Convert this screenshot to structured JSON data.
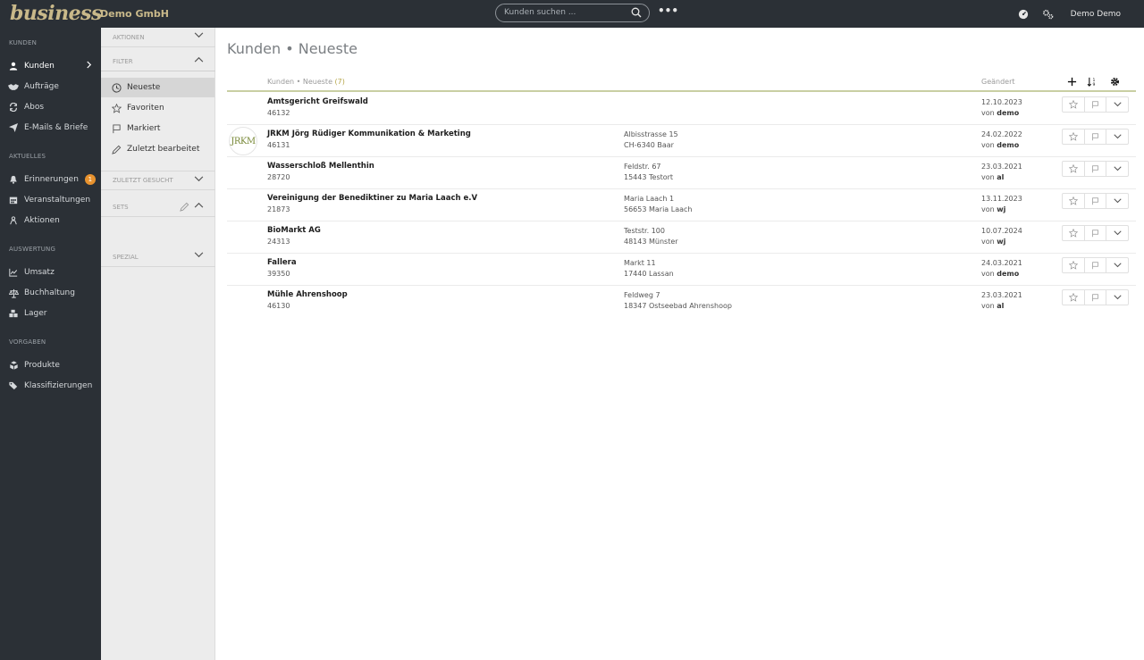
{
  "topbar": {
    "logo": "business",
    "company": "Demo GmbH",
    "search_placeholder": "Kunden suchen ...",
    "more": "•••",
    "user": "Demo Demo"
  },
  "sidebar": {
    "sections": {
      "kunden": "KUNDEN",
      "aktuelles": "AKTUELLES",
      "auswertung": "AUSWERTUNG",
      "vorgaben": "VORGABEN"
    },
    "items": [
      {
        "label": "Kunden",
        "icon": "user-icon"
      },
      {
        "label": "Aufträge",
        "icon": "handshake-icon"
      },
      {
        "label": "Abos",
        "icon": "refresh-icon"
      },
      {
        "label": "E-Mails & Briefe",
        "icon": "paper-plane-icon"
      },
      {
        "label": "Erinnerungen",
        "icon": "bell-icon",
        "badge": "1"
      },
      {
        "label": "Veranstaltungen",
        "icon": "calendar-icon"
      },
      {
        "label": "Aktionen",
        "icon": "people-icon"
      },
      {
        "label": "Umsatz",
        "icon": "chart-line-icon"
      },
      {
        "label": "Buchhaltung",
        "icon": "scale-icon"
      },
      {
        "label": "Lager",
        "icon": "boxes-icon"
      },
      {
        "label": "Produkte",
        "icon": "cubes-icon"
      },
      {
        "label": "Klassifizierungen",
        "icon": "tags-icon"
      }
    ]
  },
  "panel": {
    "aktionen": "AKTIONEN",
    "filter": "FILTER",
    "filters": [
      {
        "label": "Neueste"
      },
      {
        "label": "Favoriten"
      },
      {
        "label": "Markiert"
      },
      {
        "label": "Zuletzt bearbeitet"
      }
    ],
    "zuletzt_gesucht": "ZULETZT GESUCHT",
    "sets": "SETS",
    "spezial": "SPEZIAL"
  },
  "main": {
    "title": "Kunden • Neueste",
    "list_title": "Kunden • Neueste",
    "count": "(7)",
    "changed_label": "Geändert",
    "rows": [
      {
        "name": "Amtsgericht Greifswald",
        "number": "46132",
        "addr1": "",
        "addr2": "",
        "date": "12.10.2023",
        "by_prefix": "von",
        "by": "demo",
        "logo": ""
      },
      {
        "name": "JRKM Jörg Rüdiger Kommunikation & Marketing",
        "number": "46131",
        "addr1": "Albisstrasse 15",
        "addr2": "CH-6340 Baar",
        "date": "24.02.2022",
        "by_prefix": "von",
        "by": "demo",
        "logo": "JRKM"
      },
      {
        "name": "Wasserschloß Mellenthin",
        "number": "28720",
        "addr1": "Feldstr. 67",
        "addr2": "15443 Testort",
        "date": "23.03.2021",
        "by_prefix": "von",
        "by": "al",
        "logo": ""
      },
      {
        "name": "Vereinigung der Benediktiner zu Maria Laach e.V",
        "number": "21873",
        "addr1": "Maria Laach 1",
        "addr2": "56653 Maria Laach",
        "date": "13.11.2023",
        "by_prefix": "von",
        "by": "wj",
        "logo": ""
      },
      {
        "name": "BioMarkt AG",
        "number": "24313",
        "addr1": "Teststr. 100",
        "addr2": "48143 Münster",
        "date": "10.07.2024",
        "by_prefix": "von",
        "by": "wj",
        "logo": ""
      },
      {
        "name": "Fallera",
        "number": "39350",
        "addr1": "Markt 11",
        "addr2": "17440 Lassan",
        "date": "24.03.2021",
        "by_prefix": "von",
        "by": "demo",
        "logo": ""
      },
      {
        "name": "Mühle Ahrenshoop",
        "number": "46130",
        "addr1": "Feldweg 7",
        "addr2": "18347 Ostseebad Ahrenshoop",
        "date": "23.03.2021",
        "by_prefix": "von",
        "by": "al",
        "logo": ""
      }
    ]
  },
  "colors": {
    "dark": "#2b3036",
    "gold": "#c9b98a",
    "badge": "#e8922e",
    "accent_line": "#c9cfa3"
  }
}
